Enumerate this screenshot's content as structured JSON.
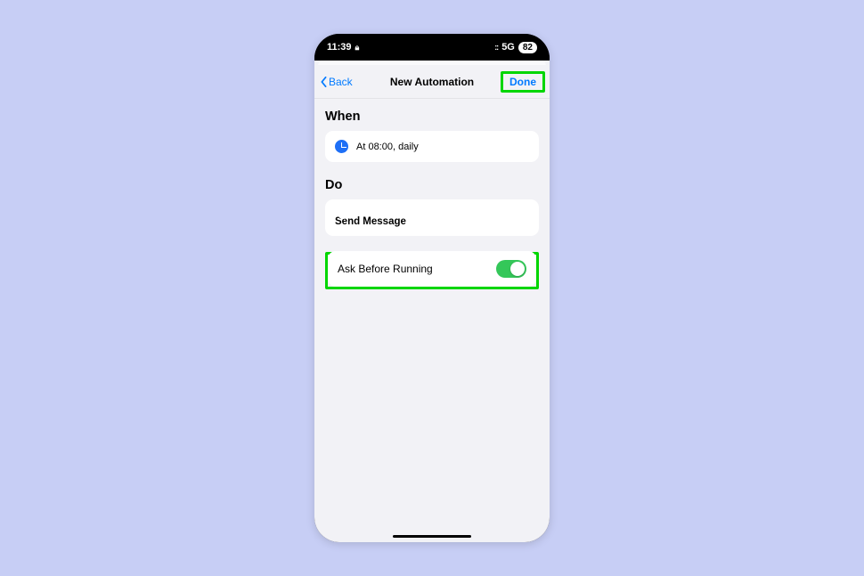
{
  "status": {
    "time": "11:39",
    "network": "5G",
    "battery": "82"
  },
  "nav": {
    "back_label": "Back",
    "title": "New Automation",
    "done_label": "Done"
  },
  "sections": {
    "when": {
      "header": "When",
      "trigger_text": "At 08:00, daily"
    },
    "do": {
      "header": "Do",
      "action_label": "Send Message"
    }
  },
  "ask_before_running": {
    "label": "Ask Before Running",
    "enabled": true
  }
}
